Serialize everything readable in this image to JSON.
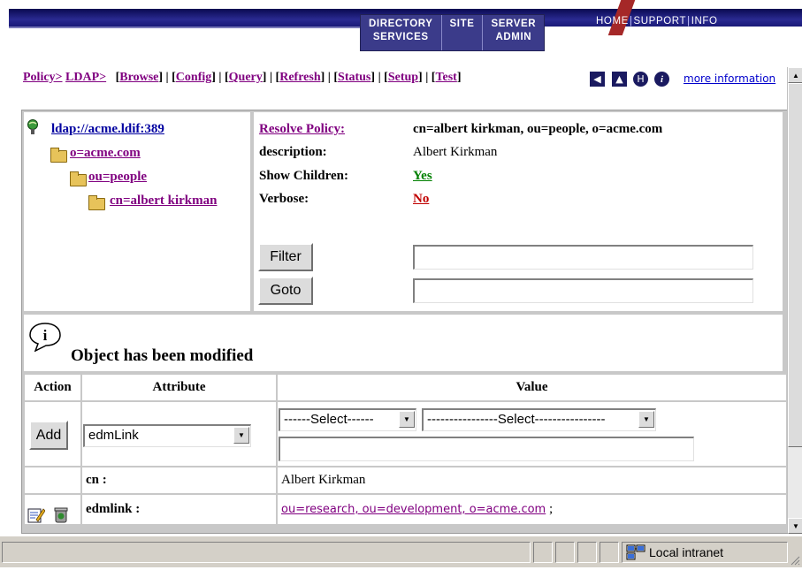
{
  "header": {
    "tabs": [
      {
        "line1": "DIRECTORY",
        "line2": "SERVICES"
      },
      {
        "line1": "SITE",
        "line2": ""
      },
      {
        "line1": "SERVER",
        "line2": "ADMIN"
      }
    ],
    "links": [
      "HOME",
      "SUPPORT",
      "INFO"
    ]
  },
  "toolbar": {
    "breadcrumb": [
      "Policy>",
      "LDAP>"
    ],
    "commands": [
      "Browse",
      "Config",
      "Query",
      "Refresh",
      "Status",
      "Setup",
      "Test"
    ],
    "more_information": "more information"
  },
  "tree": {
    "root": "ldap://acme.ldif:389",
    "nodes": [
      "o=acme.com",
      "ou=people",
      "cn=albert kirkman"
    ]
  },
  "properties": {
    "resolve_policy_label": "Resolve Policy:",
    "resolve_policy_value": "cn=albert kirkman, ou=people, o=acme.com",
    "description_label": "description:",
    "description_value": "Albert Kirkman",
    "show_children_label": "Show Children:",
    "show_children_value": "Yes",
    "verbose_label": "Verbose:",
    "verbose_value": "No",
    "filter_button": "Filter",
    "goto_button": "Goto",
    "filter_value": "",
    "goto_value": ""
  },
  "message": {
    "text": "Object has been modified"
  },
  "attributes": {
    "columns": [
      "Action",
      "Attribute",
      "Value"
    ],
    "add_button": "Add",
    "attribute_select": "edmLink",
    "value_select_1": "------Select------",
    "value_select_2": "----------------Select----------------",
    "value_input": "",
    "rows": [
      {
        "attribute": "cn :",
        "value": "Albert Kirkman"
      },
      {
        "attribute": "edmlink :",
        "value": "ou=research, ou=development, o=acme.com",
        "suffix": ";"
      }
    ]
  },
  "statusbar": {
    "zone": "Local intranet"
  }
}
